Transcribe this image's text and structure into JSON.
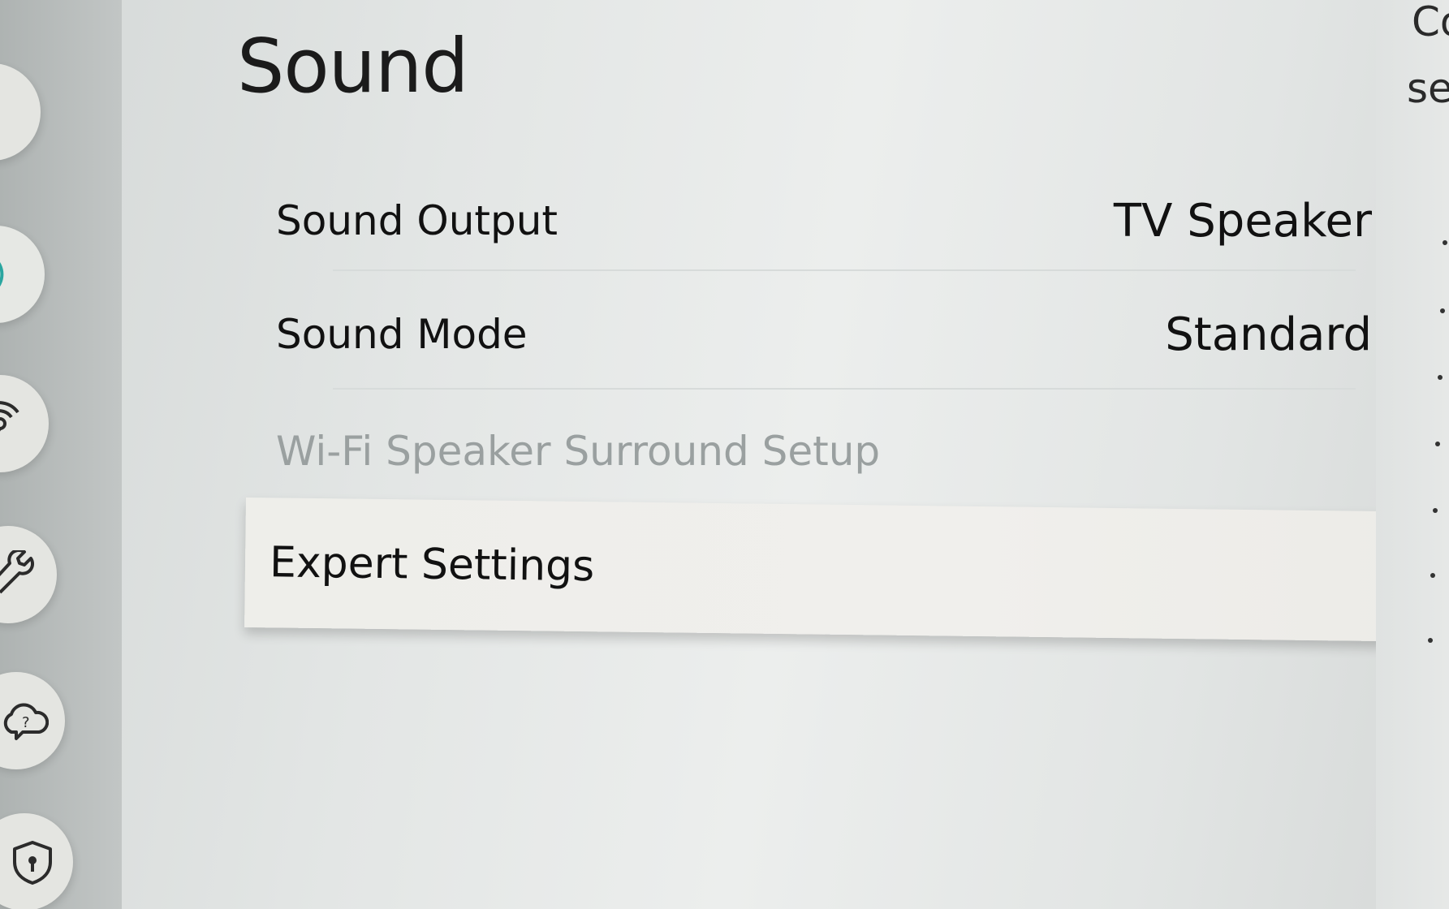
{
  "page": {
    "title": "Sound"
  },
  "menu": {
    "items": [
      {
        "label": "Sound Output",
        "value": "TV Speaker",
        "state": "normal"
      },
      {
        "label": "Sound Mode",
        "value": "Standard",
        "state": "normal"
      },
      {
        "label": "Wi-Fi Speaker Surround Setup",
        "value": "",
        "state": "disabled"
      },
      {
        "label": "Expert Settings",
        "value": "",
        "state": "selected"
      }
    ]
  },
  "sidebar": {
    "icons": [
      {
        "name": "picture-icon"
      },
      {
        "name": "sound-icon"
      },
      {
        "name": "connection-icon"
      },
      {
        "name": "general-icon"
      },
      {
        "name": "support-icon"
      },
      {
        "name": "privacy-icon"
      }
    ],
    "active_index": 1
  },
  "help_panel": {
    "lines": [
      "Co",
      "se"
    ]
  },
  "colors": {
    "background": "#e3e6e5",
    "selected_row": "#eeeeea",
    "text": "#111111",
    "disabled_text": "#9aa0a0",
    "accent": "#2aa6a0"
  }
}
